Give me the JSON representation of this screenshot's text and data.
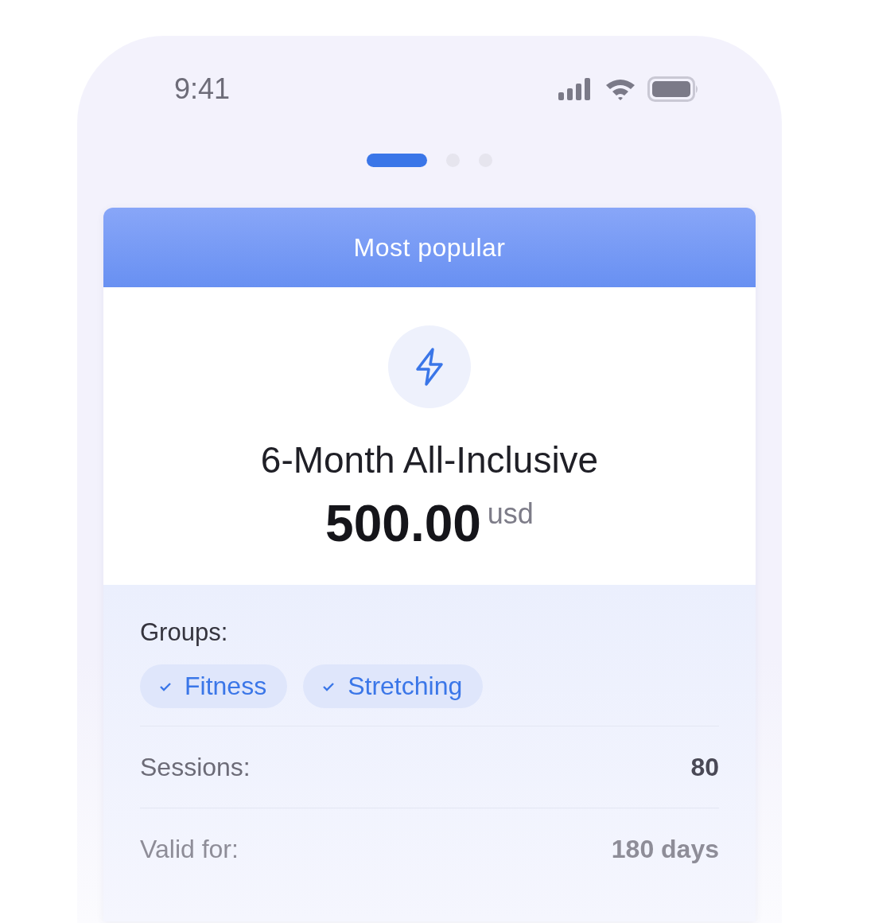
{
  "status_bar": {
    "time": "9:41"
  },
  "pager": [
    {
      "selected": true
    },
    {
      "selected": false
    },
    {
      "selected": false
    }
  ],
  "plan": {
    "badge": "Most popular",
    "title": "6-Month All-Inclusive",
    "price": "500.00",
    "currency": "usd",
    "groups_label": "Groups:",
    "groups": [
      "Fitness",
      "Stretching"
    ],
    "details": [
      {
        "label": "Sessions:",
        "value": "80"
      },
      {
        "label": "Valid for:",
        "value": "180 days"
      }
    ]
  }
}
